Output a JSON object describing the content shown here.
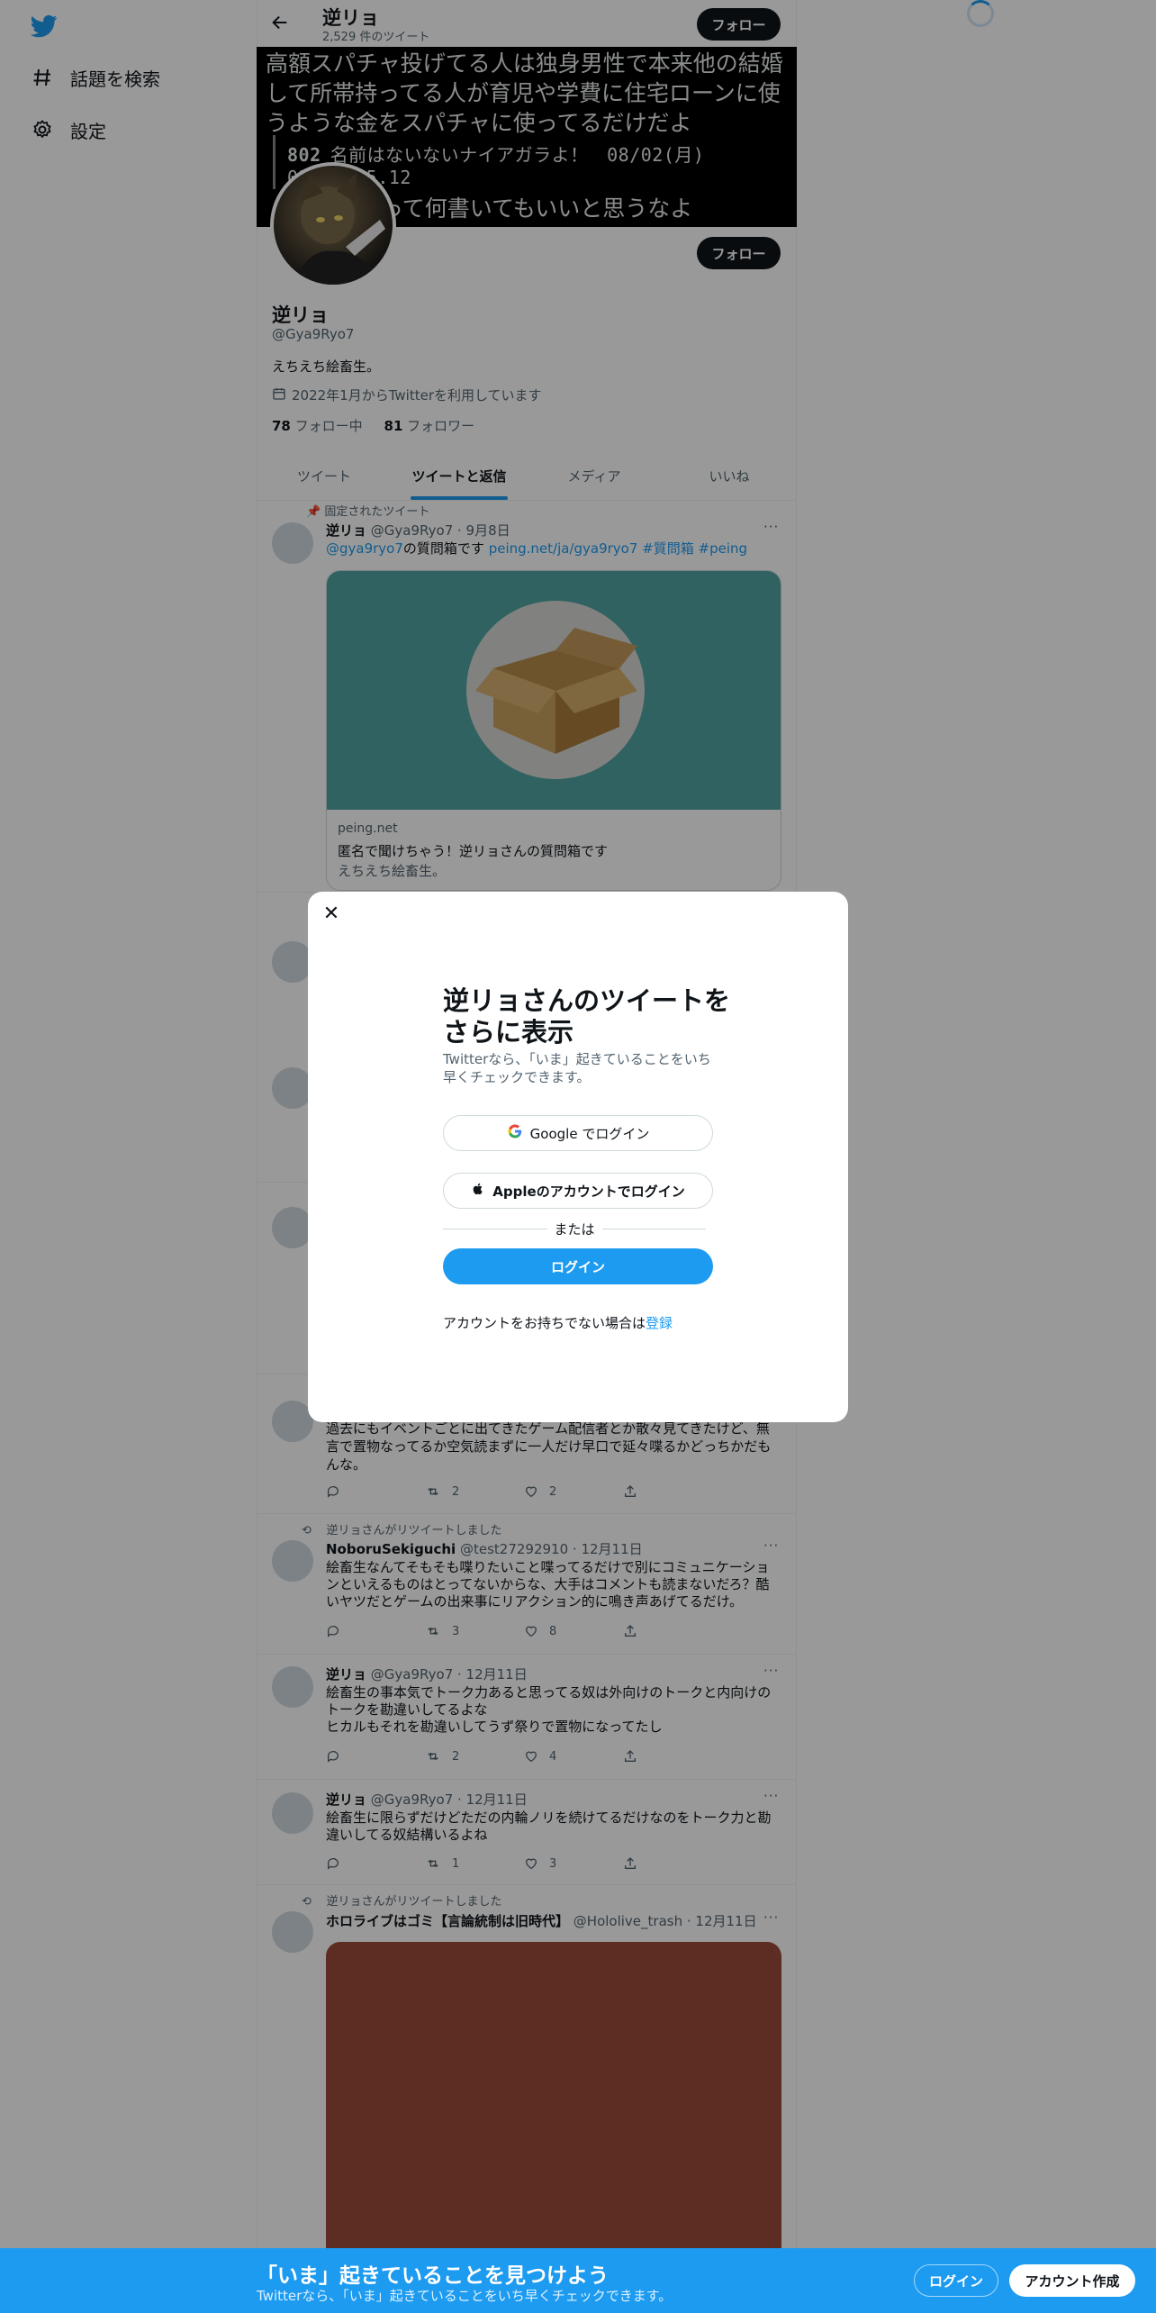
{
  "nav": {
    "items": [
      {
        "label": "話題を検索",
        "icon": "hashtag-icon"
      },
      {
        "label": "設定",
        "icon": "gear-icon"
      }
    ]
  },
  "header": {
    "name": "逆リョ",
    "tweet_count": "2,529 件のツイート",
    "follow_label": "フォロー"
  },
  "banner": {
    "text": "高額スパチャ投げてる人は独身男性で本来他の結婚して所帯持ってる人が育児や学費に住宅ローンに使うような金をスパチャに使ってるだけだよ",
    "post_number": "802",
    "post_meta": "名前はないないナイアガラよ！　08/02(月) 02:05:15.12",
    "sub_text": "って何書いてもいいと思うなよ"
  },
  "profile": {
    "name": "逆リョ",
    "handle": "@Gya9Ryo7",
    "bio": "えちえち絵畜生。",
    "joined": "2022年1月からTwitterを利用しています",
    "following_count": "78",
    "following_label": "フォロー中",
    "followers_count": "81",
    "followers_label": "フォロワー",
    "follow_label": "フォロー"
  },
  "tabs": [
    "ツイート",
    "ツイートと返信",
    "メディア",
    "いいね"
  ],
  "tweets": [
    {
      "context": "固定されたツイート",
      "name": "逆リョ",
      "handle": "@Gya9Ryo7",
      "date": "· 9月8日",
      "mention": "@gya9ryo7",
      "text_mid": "の質問箱です",
      "link": "peing.net/ja/gya9ryo7",
      "hashtags": "#質問箱 #peing",
      "card": {
        "domain": "peing.net",
        "title": "匿名で聞けちゃう！逆リョさんの質問箱です",
        "desc": "えちえち絵畜生。"
      }
    },
    {
      "text": "過去にもイベントごとに出てきたゲーム配信者とか散々見てきたけど、無言で置物なってるか空気読まずに一人だけ早口で延々喋るかどっちかだもんな。",
      "replies": "",
      "retweets": "2",
      "likes": "2"
    },
    {
      "context": "逆リョさんがリツイートしました",
      "name": "NoboruSekiguchi",
      "handle": "@test27292910",
      "date": "· 12月11日",
      "text": "絵畜生なんてそもそも喋りたいこと喋ってるだけで別にコミュニケーションといえるものはとってないからな、大手はコメントも読まないだろ？酷いヤツだとゲームの出来事にリアクション的に鳴き声あげてるだけ。",
      "retweets": "3",
      "likes": "8"
    },
    {
      "name": "逆リョ",
      "handle": "@Gya9Ryo7",
      "date": "· 12月11日",
      "text": "絵畜生の事本気でトーク力あると思ってる奴は外向けのトークと内向けのトークを勘違いしてるよな\nヒカルもそれを勘違いしてうず祭りで置物になってたし",
      "retweets": "2",
      "likes": "4"
    },
    {
      "name": "逆リョ",
      "handle": "@Gya9Ryo7",
      "date": "· 12月11日",
      "text": "絵畜生に限らずだけどただの内輪ノリを続けてるだけなのをトーク力と勘違いしてる奴結構いるよね",
      "retweets": "1",
      "likes": "3"
    },
    {
      "context": "逆リョさんがリツイートしました",
      "name": "ホロライブはゴミ【言論統制は旧時代】",
      "handle": "@Hololive_trash",
      "date": "· 12月11日"
    }
  ],
  "modal": {
    "title": "逆リョさんのツイートをさらに表示",
    "subtitle": "Twitterなら、「いま」起きていることをいち早くチェックできます。",
    "google_label": "Google でログイン",
    "apple_label": "Appleのアカウントでログイン",
    "or_label": "または",
    "login_label": "ログイン",
    "signup_prompt": "アカウントをお持ちでない場合は",
    "signup_link": "登録"
  },
  "bottom_bar": {
    "title": "「いま」起きていることを見つけよう",
    "subtitle": "Twitterなら、「いま」起きていることをいち早くチェックできます。",
    "login_label": "ログイン",
    "create_label": "アカウント作成"
  },
  "colors": {
    "accent": "#1d9bf0",
    "text": "#0f1419",
    "muted": "#536471"
  }
}
